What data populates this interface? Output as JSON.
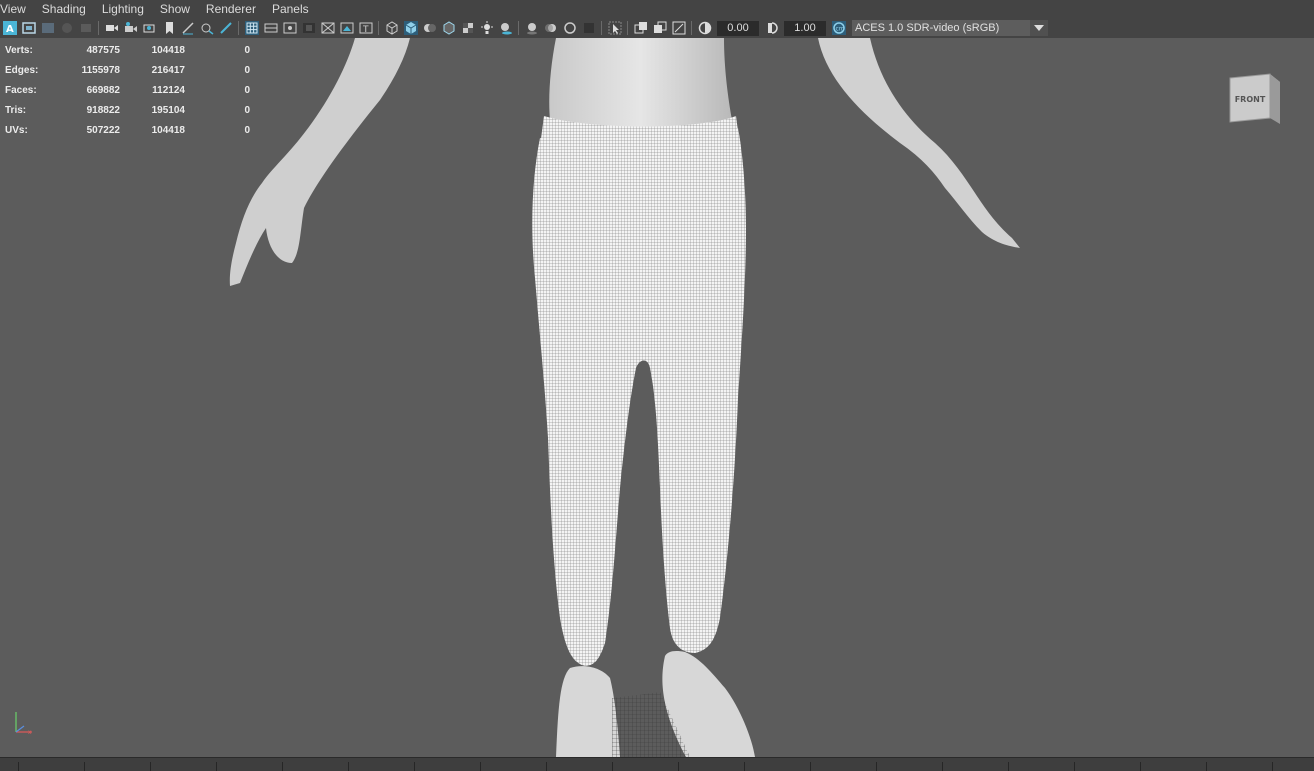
{
  "menu": [
    "View",
    "Shading",
    "Lighting",
    "Show",
    "Renderer",
    "Panels"
  ],
  "toolbar": {
    "exposure_value": "0.00",
    "gamma_value": "1.00",
    "color_transform": "ACES 1.0 SDR-video (sRGB)",
    "icons": [
      "select-camera-icon",
      "camera-attributes-icon",
      "bookmark-icon",
      "image-plane-icon",
      "camera-icon",
      "lock-camera-icon",
      "snapshot-icon",
      "bookmark-flag-icon",
      "grease-pencil-icon",
      "grid-icon",
      "film-gate-icon",
      "resolution-gate-icon",
      "gate-mask-icon",
      "field-chart-icon",
      "safe-action-icon",
      "safe-title-icon",
      "wireframe-icon",
      "smooth-shade-icon",
      "default-material-icon",
      "wireframe-on-shaded-icon",
      "textured-icon",
      "lights-icon",
      "shadows-icon",
      "ambient-occlusion-icon",
      "motion-blur-icon",
      "anti-alias-icon",
      "depth-of-field-icon",
      "isolate-select-icon",
      "xray-icon",
      "xray-joints-icon",
      "backface-culling-icon",
      "exposure-icon",
      "gamma-icon",
      "color-management-icon"
    ]
  },
  "hud": {
    "rows": [
      {
        "label": "Verts:",
        "v1": "487575",
        "v2": "104418",
        "v3": "0"
      },
      {
        "label": "Edges:",
        "v1": "1155978",
        "v2": "216417",
        "v3": "0"
      },
      {
        "label": "Faces:",
        "v1": "669882",
        "v2": "112124",
        "v3": "0"
      },
      {
        "label": "Tris:",
        "v1": "918822",
        "v2": "195104",
        "v3": "0"
      },
      {
        "label": "UVs:",
        "v1": "507222",
        "v2": "104418",
        "v3": "0"
      }
    ]
  },
  "viewcube": {
    "label": "FRONT"
  },
  "colors": {
    "viewport_bg": "#5c5c5c",
    "ui_bg": "#444444",
    "accent": "#4bb5d6"
  }
}
